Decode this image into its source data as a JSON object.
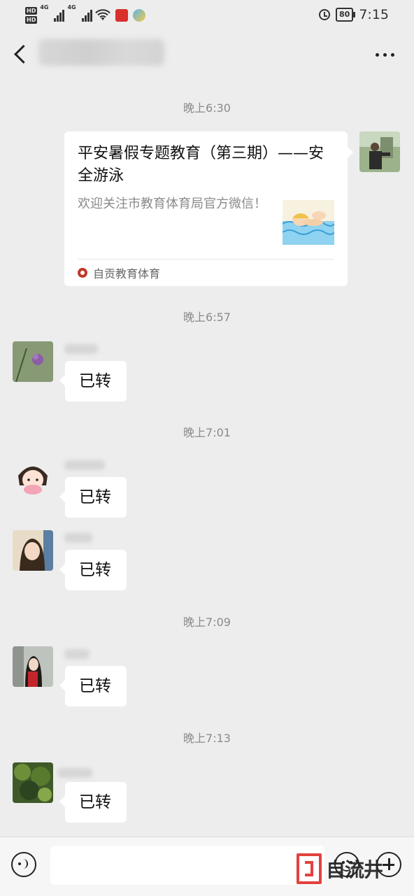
{
  "status_bar": {
    "hd_labels": [
      "HD",
      "HD"
    ],
    "network_labels": [
      "4G",
      "4G"
    ],
    "battery": "80",
    "time": "7:15"
  },
  "messages": {
    "t1": "晚上6:30",
    "card": {
      "title": "平安暑假专题教育（第三期）——安全游泳",
      "description": "欢迎关注市教育体育局官方微信！",
      "source": "自贡教育体育"
    },
    "t2": "晚上6:57",
    "m1": "已转",
    "t3": "晚上7:01",
    "m2": "已转",
    "m3": "已转",
    "t4": "晚上7:09",
    "m4": "已转",
    "t5": "晚上7:13",
    "m5": "已转"
  },
  "input_bar": {
    "watermark": "自流井"
  },
  "colors": {
    "background": "#ededed",
    "bubble": "#ffffff",
    "timestamp": "#8a8a8a",
    "watermark_red": "#e0322f"
  },
  "icons": [
    "back-icon",
    "more-icon",
    "alarm-icon",
    "battery-icon",
    "wifi-icon",
    "voice-icon",
    "emoji-icon",
    "plus-icon"
  ]
}
